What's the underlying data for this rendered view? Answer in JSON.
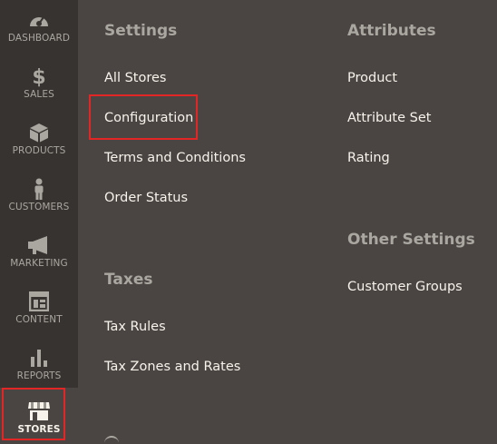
{
  "sidebar": {
    "items": [
      {
        "label": "DASHBOARD",
        "icon": "dashboard-icon"
      },
      {
        "label": "SALES",
        "icon": "dollar-icon"
      },
      {
        "label": "PRODUCTS",
        "icon": "cube-icon"
      },
      {
        "label": "CUSTOMERS",
        "icon": "person-icon"
      },
      {
        "label": "MARKETING",
        "icon": "megaphone-icon"
      },
      {
        "label": "CONTENT",
        "icon": "layout-icon"
      },
      {
        "label": "REPORTS",
        "icon": "bar-chart-icon"
      },
      {
        "label": "STORES",
        "icon": "storefront-icon",
        "active": true
      }
    ]
  },
  "menu": {
    "settings": {
      "heading": "Settings",
      "links": [
        "All Stores",
        "Configuration",
        "Terms and Conditions",
        "Order Status"
      ]
    },
    "taxes": {
      "heading": "Taxes",
      "links": [
        "Tax Rules",
        "Tax Zones and Rates"
      ]
    },
    "attributes": {
      "heading": "Attributes",
      "links": [
        "Product",
        "Attribute Set",
        "Rating"
      ]
    },
    "other_settings": {
      "heading": "Other Settings",
      "links": [
        "Customer Groups"
      ]
    }
  },
  "colors": {
    "sidebar_bg": "#373330",
    "panel_bg": "#4a4542",
    "highlight": "#e22626",
    "heading": "#aaa6a0",
    "link": "#f7f3eb"
  }
}
